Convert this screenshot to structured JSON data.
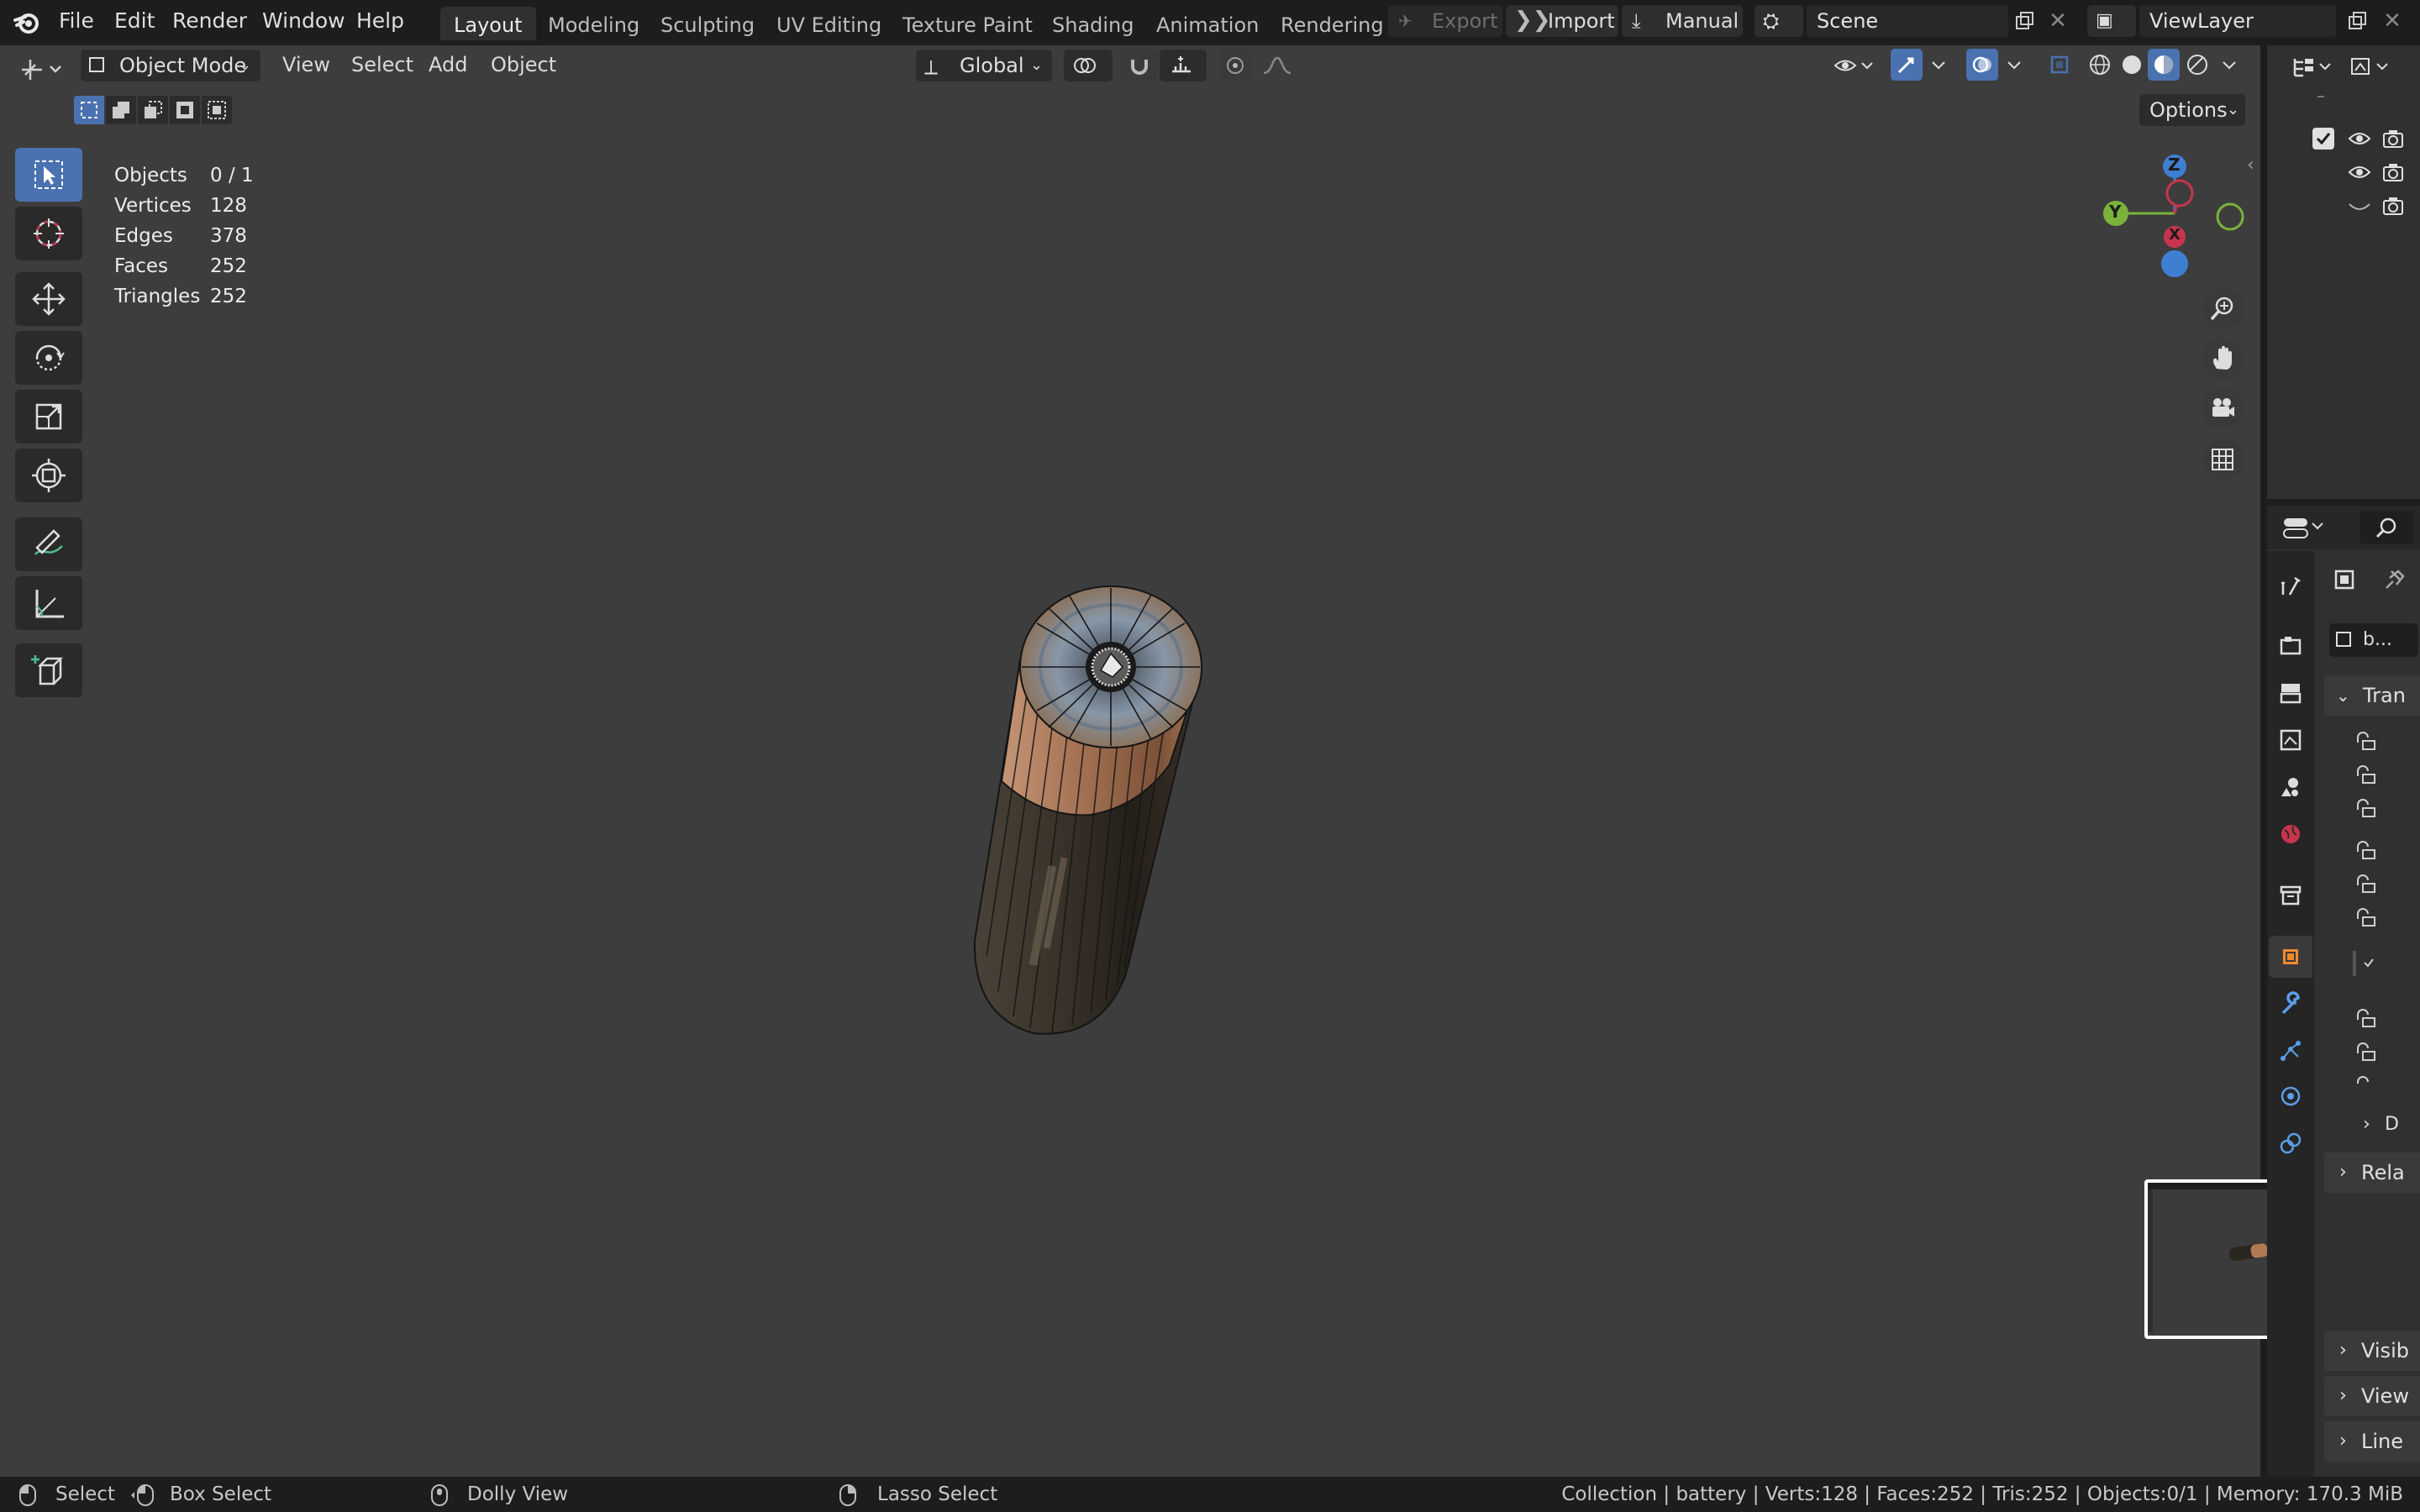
{
  "menubar": {
    "items": [
      "File",
      "Edit",
      "Render",
      "Window",
      "Help"
    ]
  },
  "workspaces": {
    "tabs": [
      "Layout",
      "Modeling",
      "Sculpting",
      "UV Editing",
      "Texture Paint",
      "Shading",
      "Animation",
      "Rendering"
    ],
    "active": "Layout"
  },
  "header_buttons": {
    "export": "Export",
    "import": "Import",
    "manual": "Manual"
  },
  "scene": {
    "name": "Scene"
  },
  "view_layer": {
    "name": "ViewLayer"
  },
  "viewport_header": {
    "mode": "Object Mode",
    "menus": [
      "View",
      "Select",
      "Add",
      "Object"
    ],
    "orientation": "Global",
    "options": "Options"
  },
  "stats": {
    "rows": [
      {
        "label": "Objects",
        "value": "0 / 1"
      },
      {
        "label": "Vertices",
        "value": "128"
      },
      {
        "label": "Edges",
        "value": "378"
      },
      {
        "label": "Faces",
        "value": "252"
      },
      {
        "label": "Triangles",
        "value": "252"
      }
    ]
  },
  "gizmo": {
    "z": "Z",
    "y": "Y",
    "x": "X"
  },
  "properties": {
    "object_name": "b...",
    "panels": [
      "Tran",
      "D",
      "Rela",
      "Visib",
      "View",
      "Line"
    ]
  },
  "statusbar": {
    "select": "Select",
    "box_select": "Box Select",
    "dolly_view": "Dolly View",
    "lasso_select": "Lasso Select",
    "info": "Collection | battery | Verts:128 | Faces:252 | Tris:252 | Objects:0/1 | Memory: 170.3 MiB"
  },
  "colors": {
    "viewport_bg": "#3d3d3d",
    "active_blue": "#4a72b0",
    "axis_x": "#c8354b",
    "axis_y": "#7ab23a",
    "axis_z": "#3f7fd1",
    "battery_copper": "#b07a55",
    "battery_body": "#2f2a22"
  }
}
